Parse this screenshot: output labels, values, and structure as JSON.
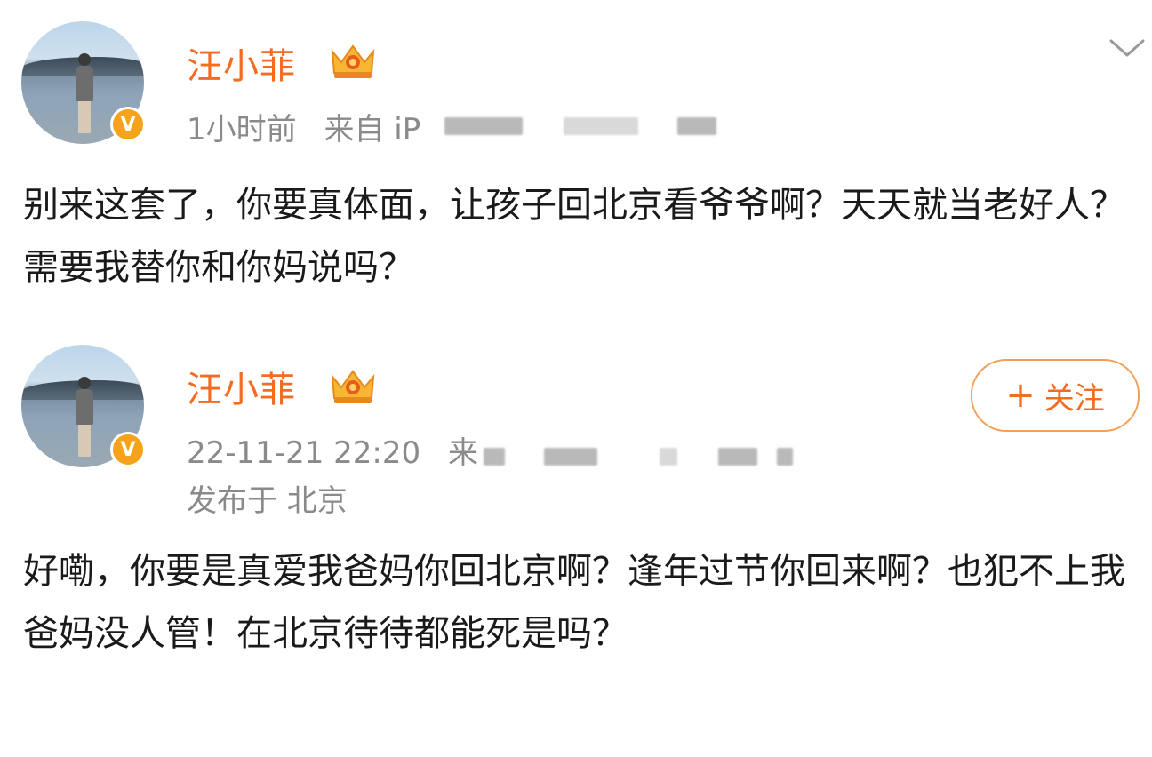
{
  "post1": {
    "username": "汪小菲",
    "time": "1小时前",
    "source": "来自 iP",
    "text": "别来这套了，你要真体面，让孩子回北京看爷爷啊？天天就当老好人？需要我替你和你妈说吗？"
  },
  "post2": {
    "username": "汪小菲",
    "time": "22-11-21 22:20",
    "source": "来",
    "location": "发布于 北京",
    "follow_plus": "+",
    "follow_label": "关注",
    "text": "好嘞，你要是真爱我爸妈你回北京啊？逢年过节你回来啊？也犯不上我爸妈没人管！在北京待待都能死是吗？"
  },
  "icons": {
    "verified": "verified-badge-icon",
    "vip": "crown-icon",
    "menu": "chevron-down-icon"
  },
  "colors": {
    "accent": "#f36c21",
    "badge": "#f6a21a",
    "meta": "#8a8a8a"
  }
}
